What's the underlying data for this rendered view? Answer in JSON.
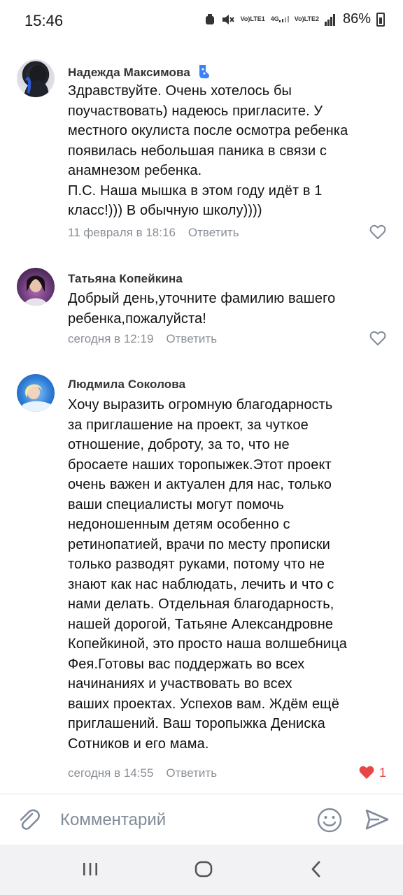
{
  "status_bar": {
    "time": "15:46",
    "sim1": "LTE1",
    "sim2": "LTE2",
    "net": "4G",
    "battery": "86%"
  },
  "comments": [
    {
      "author": "Надежда Максимова",
      "text": "Здравствуйте. Очень хотелось бы\nпоучаствовать) надеюсь пригласите. У\nместного окулиста после осмотра ребенка\nпоявилась небольшая паника в связи с\nанамнезом ребенка.\nП.С. Наша мышка в этом году идёт в 1\nкласс!))) В обычную школу))))",
      "date": "11 февраля в 18:16",
      "reply": "Ответить",
      "liked": false,
      "likes": ""
    },
    {
      "author": "Татьяна Копейкина",
      "text": "Добрый день,уточните фамилию  вашего\nребенка,пожалуйста!",
      "date": "сегодня в 12:19",
      "reply": "Ответить",
      "liked": false,
      "likes": ""
    },
    {
      "author": "Людмила Соколова",
      "text": "Хочу выразить огромную благодарность\nза приглашение на проект, за чуткое\nотношение, доброту, за то, что не\nбросаете наших торопыжек.Этот проект\nочень важен и актуален для нас, только\nваши специалисты могут помочь\nнедоношенным детям особенно с\nретинопатией, врачи по месту прописки\nтолько разводят руками, потому что не\nзнают как нас наблюдать, лечить и что с\nнами делать. Отдельная благодарность,\nнашей дорогой, Татьяне Александровне\nКопейкиной, это просто наша волшебница\nФея.Готовы вас поддержать во всех\nначинаниях и участвовать во всех\nваших проектах. Успехов вам. Ждём ещё\nприглашений. Ваш торопыжка Дениска\nСотников и его мама.",
      "date": "сегодня в 14:55",
      "reply": "Ответить",
      "liked": true,
      "likes": "1"
    }
  ],
  "input": {
    "placeholder": "Комментарий"
  },
  "colors": {
    "accent_like": "#e64646",
    "meta": "#8a8f96",
    "icon": "#818c99"
  }
}
